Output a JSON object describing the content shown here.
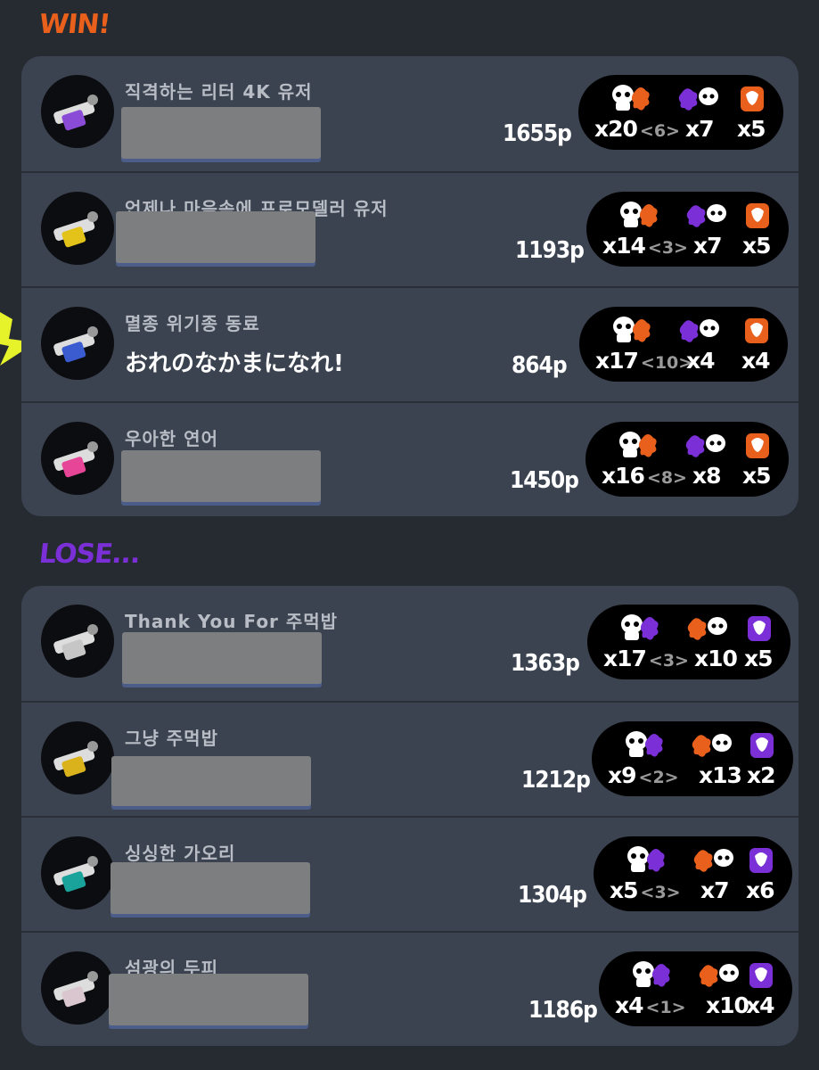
{
  "sections": {
    "win": "WIN!",
    "lose": "LOSE..."
  },
  "win_players": [
    {
      "nickname": "직격하는 리터 4K 유저",
      "name": "",
      "points": "1655p",
      "kills": "x20",
      "assists": "<6>",
      "specials": "x7",
      "special_count": "x5",
      "special_color": "#e8601c"
    },
    {
      "nickname": "언제나 마음속에 프로모델러 유저",
      "name": "",
      "points": "1193p",
      "kills": "x14",
      "assists": "<3>",
      "specials": "x7",
      "special_count": "x5",
      "special_color": "#e8601c"
    },
    {
      "nickname": "멸종 위기종 동료",
      "name": "おれのなかまになれ!",
      "points": "864p",
      "kills": "x17",
      "assists": "<10>",
      "specials": "x4",
      "special_count": "x4",
      "special_color": "#e8601c"
    },
    {
      "nickname": "우아한 연어",
      "name": "",
      "points": "1450p",
      "kills": "x16",
      "assists": "<8>",
      "specials": "x8",
      "special_count": "x5",
      "special_color": "#e8601c"
    }
  ],
  "lose_players": [
    {
      "nickname": "Thank You For 주먹밥",
      "name": "",
      "points": "1363p",
      "kills": "x17",
      "assists": "<3>",
      "specials": "x10",
      "special_count": "x5",
      "special_color": "#7b2fd6"
    },
    {
      "nickname": "그냥 주먹밥",
      "name": "",
      "points": "1212p",
      "kills": "x9",
      "assists": "<2>",
      "specials": "x13",
      "special_count": "x2",
      "special_color": "#7b2fd6"
    },
    {
      "nickname": "싱싱한 가오리",
      "name": "",
      "points": "1304p",
      "kills": "x5",
      "assists": "<3>",
      "specials": "x7",
      "special_count": "x6",
      "special_color": "#7b2fd6"
    },
    {
      "nickname": "섬광의 두피",
      "name": "",
      "points": "1186p",
      "kills": "x4",
      "assists": "<1>",
      "specials": "x10",
      "special_count": "x4",
      "special_color": "#7b2fd6"
    }
  ],
  "colors": {
    "win_accent": "#e8601c",
    "lose_accent": "#7b2fd6",
    "panel": "#3b4250",
    "background": "#262a31"
  },
  "icons": {
    "kill": "squid-skull-splat-icon",
    "death": "squid-splat-icon",
    "special": "special-weapon-icon"
  }
}
